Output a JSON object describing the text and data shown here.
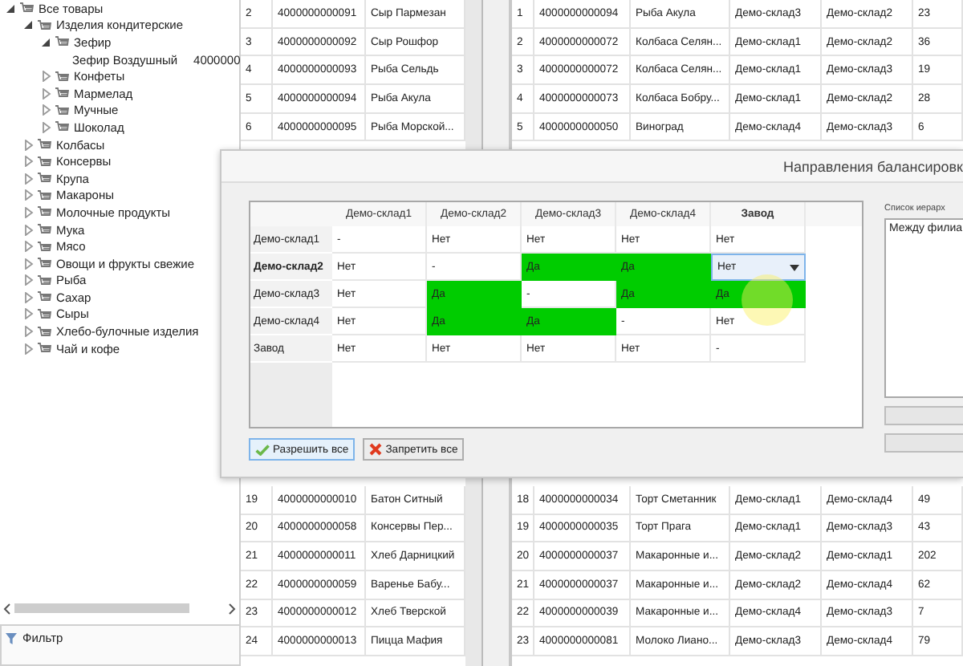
{
  "tree": [
    {
      "label": "Все товары",
      "kind": "group",
      "expanded": true,
      "children": [
        {
          "label": "Изделия кондитерские",
          "kind": "group",
          "expanded": true,
          "children": [
            {
              "label": "Зефир",
              "kind": "group",
              "expanded": true,
              "children": [
                {
                  "label": "Зефир Воздушный",
                  "code": "4000000"
                }
              ]
            },
            {
              "label": "Конфеты",
              "kind": "group",
              "expanded": false
            },
            {
              "label": "Мармелад",
              "kind": "group",
              "expanded": false
            },
            {
              "label": "Мучные",
              "kind": "group",
              "expanded": false
            },
            {
              "label": "Шоколад",
              "kind": "group",
              "expanded": false
            }
          ]
        },
        {
          "label": "Колбасы",
          "kind": "group",
          "expanded": false
        },
        {
          "label": "Консервы",
          "kind": "group",
          "expanded": false
        },
        {
          "label": "Крупа",
          "kind": "group",
          "expanded": false
        },
        {
          "label": "Макароны",
          "kind": "group",
          "expanded": false
        },
        {
          "label": "Молочные продукты",
          "kind": "group",
          "expanded": false
        },
        {
          "label": "Мука",
          "kind": "group",
          "expanded": false
        },
        {
          "label": "Мясо",
          "kind": "group",
          "expanded": false
        },
        {
          "label": "Овощи и фрукты свежие",
          "kind": "group",
          "expanded": false
        },
        {
          "label": "Рыба",
          "kind": "group",
          "expanded": false
        },
        {
          "label": "Сахар",
          "kind": "group",
          "expanded": false
        },
        {
          "label": "Сыры",
          "kind": "group",
          "expanded": false
        },
        {
          "label": "Хлебо-булочные изделия",
          "kind": "group",
          "expanded": false
        },
        {
          "label": "Чай и кофе",
          "kind": "group",
          "expanded": false
        }
      ]
    }
  ],
  "filter": {
    "title": "Фильтр"
  },
  "products_table": {
    "rows_above_dialog": [
      {
        "num": "2",
        "code": "4000000000091",
        "name": "Сыр Пармезан"
      },
      {
        "num": "3",
        "code": "4000000000092",
        "name": "Сыр Рошфор"
      },
      {
        "num": "4",
        "code": "4000000000093",
        "name": "Рыба Сельдь"
      },
      {
        "num": "5",
        "code": "4000000000094",
        "name": "Рыба Акула"
      },
      {
        "num": "6",
        "code": "4000000000095",
        "name": "Рыба Морской..."
      }
    ],
    "rows_below_dialog": [
      {
        "num": "19",
        "code": "4000000000010",
        "name": "Батон Ситный"
      },
      {
        "num": "20",
        "code": "4000000000058",
        "name": "Консервы Пер..."
      },
      {
        "num": "21",
        "code": "4000000000011",
        "name": "Хлеб Дарницкий"
      },
      {
        "num": "22",
        "code": "4000000000059",
        "name": "Варенье Бабу..."
      },
      {
        "num": "23",
        "code": "4000000000012",
        "name": "Хлеб Тверской"
      },
      {
        "num": "24",
        "code": "4000000000013",
        "name": "Пицца Мафия"
      }
    ]
  },
  "transfers_table": {
    "rows_above_dialog": [
      {
        "num": "1",
        "code": "4000000000094",
        "name": "Рыба Акула",
        "from": "Демо-склад3",
        "to": "Демо-склад2",
        "qty": "23"
      },
      {
        "num": "2",
        "code": "4000000000072",
        "name": "Колбаса Селян...",
        "from": "Демо-склад1",
        "to": "Демо-склад2",
        "qty": "36"
      },
      {
        "num": "3",
        "code": "4000000000072",
        "name": "Колбаса Селян...",
        "from": "Демо-склад1",
        "to": "Демо-склад3",
        "qty": "19"
      },
      {
        "num": "4",
        "code": "4000000000073",
        "name": "Колбаса Бобру...",
        "from": "Демо-склад1",
        "to": "Демо-склад2",
        "qty": "28"
      },
      {
        "num": "5",
        "code": "4000000000050",
        "name": "Виноград",
        "from": "Демо-склад4",
        "to": "Демо-склад3",
        "qty": "6"
      }
    ],
    "rows_below_dialog": [
      {
        "num": "18",
        "code": "4000000000034",
        "name": "Торт Сметанник",
        "from": "Демо-склад1",
        "to": "Демо-склад4",
        "qty": "49"
      },
      {
        "num": "19",
        "code": "4000000000035",
        "name": "Торт Прага",
        "from": "Демо-склад1",
        "to": "Демо-склад3",
        "qty": "43"
      },
      {
        "num": "20",
        "code": "4000000000037",
        "name": "Макаронные и...",
        "from": "Демо-склад2",
        "to": "Демо-склад1",
        "qty": "202"
      },
      {
        "num": "21",
        "code": "4000000000037",
        "name": "Макаронные и...",
        "from": "Демо-склад2",
        "to": "Демо-склад4",
        "qty": "62"
      },
      {
        "num": "22",
        "code": "4000000000039",
        "name": "Макаронные и...",
        "from": "Демо-склад4",
        "to": "Демо-склад3",
        "qty": "7"
      },
      {
        "num": "23",
        "code": "4000000000081",
        "name": "Молоко Лиано...",
        "from": "Демо-склад3",
        "to": "Демо-склад4",
        "qty": "79"
      }
    ]
  },
  "dialog": {
    "title": "Направления балансировк",
    "matrix": {
      "columns": [
        {
          "label": "Демо-склад1",
          "selected": false
        },
        {
          "label": "Демо-склад2",
          "selected": false
        },
        {
          "label": "Демо-склад3",
          "selected": false
        },
        {
          "label": "Демо-склад4",
          "selected": false
        },
        {
          "label": "Завод",
          "selected": true
        }
      ],
      "rows": [
        {
          "label": "Демо-склад1",
          "selected": false,
          "cells": [
            {
              "text": "-",
              "allowed": false,
              "selected": false
            },
            {
              "text": "Нет",
              "allowed": false,
              "selected": false
            },
            {
              "text": "Нет",
              "allowed": false,
              "selected": false
            },
            {
              "text": "Нет",
              "allowed": false,
              "selected": false
            },
            {
              "text": "Нет",
              "allowed": false,
              "selected": false
            }
          ]
        },
        {
          "label": "Демо-склад2",
          "selected": true,
          "cells": [
            {
              "text": "Нет",
              "allowed": false,
              "selected": false
            },
            {
              "text": "-",
              "allowed": false,
              "selected": false
            },
            {
              "text": "Да",
              "allowed": true,
              "selected": false
            },
            {
              "text": "Да",
              "allowed": true,
              "selected": false
            },
            {
              "text": "Нет",
              "allowed": false,
              "selected": true
            }
          ]
        },
        {
          "label": "Демо-склад3",
          "selected": false,
          "cells": [
            {
              "text": "Нет",
              "allowed": false,
              "selected": false
            },
            {
              "text": "Да",
              "allowed": true,
              "selected": false
            },
            {
              "text": "-",
              "allowed": false,
              "selected": false
            },
            {
              "text": "Да",
              "allowed": true,
              "selected": false
            },
            {
              "text": "Да",
              "allowed": true,
              "selected": false
            }
          ]
        },
        {
          "label": "Демо-склад4",
          "selected": false,
          "cells": [
            {
              "text": "Нет",
              "allowed": false,
              "selected": false
            },
            {
              "text": "Да",
              "allowed": true,
              "selected": false
            },
            {
              "text": "Да",
              "allowed": true,
              "selected": false
            },
            {
              "text": "-",
              "allowed": false,
              "selected": false
            },
            {
              "text": "Нет",
              "allowed": false,
              "selected": false
            }
          ]
        },
        {
          "label": "Завод",
          "selected": false,
          "cells": [
            {
              "text": "Нет",
              "allowed": false,
              "selected": false
            },
            {
              "text": "Нет",
              "allowed": false,
              "selected": false
            },
            {
              "text": "Нет",
              "allowed": false,
              "selected": false
            },
            {
              "text": "Нет",
              "allowed": false,
              "selected": false
            },
            {
              "text": "-",
              "allowed": false,
              "selected": false
            }
          ]
        }
      ]
    },
    "buttons": [
      {
        "label": "Разрешить все",
        "kind": "allow"
      },
      {
        "label": "Запретить все",
        "kind": "deny"
      }
    ],
    "hierarchy": {
      "label": "Список иерарх",
      "items": [
        "Между филиа"
      ]
    }
  }
}
